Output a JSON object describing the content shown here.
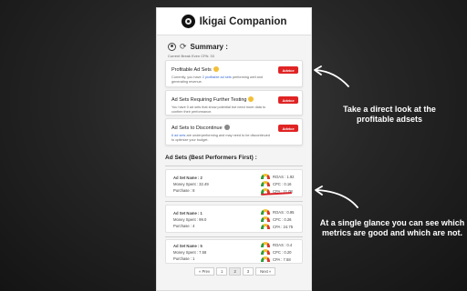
{
  "app": {
    "title": "Ikigai Companion"
  },
  "summary": {
    "title": "Summary :",
    "breakeven": "Current Break Even CPA: 33"
  },
  "cards": [
    {
      "title": "Profitable Ad Sets",
      "desc_pre": "Currently, you have ",
      "desc_hl": "2 profitable ad sets",
      "desc_post": " performing well and generating revenue.",
      "advice": "Advice"
    },
    {
      "title": "Ad Sets Requiring Further Testing",
      "desc_pre": "",
      "desc_hl": "",
      "desc_post": "You have 0 ad sets that show potential but need more data to confirm their performance.",
      "advice": "Advice"
    },
    {
      "title": "Ad Sets to Discontinue",
      "desc_pre": "",
      "desc_hl": "6 ad sets",
      "desc_post": " are underperforming and may need to be discontinued to optimize your budget.",
      "advice": "Advice"
    }
  ],
  "adsets_section": {
    "title": "Ad Sets (Best Performers First) :"
  },
  "adsets": [
    {
      "name": "Ad Set Name : 2",
      "spent": "Money Spent : 32.49",
      "purchase": "Purchase : 8",
      "roas": "ROAS : 1.92",
      "cpc": "CPC : 0.16",
      "cpa": "CPA : 11.08"
    },
    {
      "name": "Ad Set Name : 1",
      "spent": "Money Spent : 99.0",
      "purchase": "Purchase : 4",
      "roas": "ROAS : 0.95",
      "cpc": "CPC : 0.26",
      "cpa": "CPA : 24.75"
    },
    {
      "name": "Ad Set Name : 5",
      "spent": "Money Spent : 7.58",
      "purchase": "Purchase : 1",
      "roas": "ROAS : 0.4",
      "cpc": "CPC : 0.20",
      "cpa": "CPA : 7.58"
    }
  ],
  "pager": {
    "prev": "« Prev",
    "p1": "1",
    "p2": "2",
    "p3": "3",
    "next": "Next »"
  },
  "notes": {
    "note1": "Take a direct look at the profitable adsets",
    "note2": "At a single glance you can see which metrics are good and which are not."
  },
  "colors": {
    "advice": "#e02424",
    "link": "#3a6bd8",
    "underline": "#d6242a"
  }
}
